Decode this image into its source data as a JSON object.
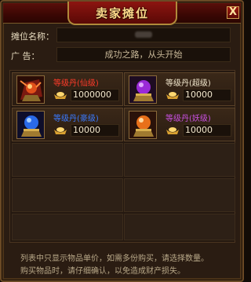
{
  "window": {
    "title": "卖家摊位",
    "close_label": "X"
  },
  "info": {
    "stall_name_label": "摊位名称：",
    "ad_label": "广   告：",
    "ad_text": "成功之路，从头开始"
  },
  "items": [
    {
      "name": "等级丹(仙级)",
      "price": "1000000",
      "name_color": "#ff3b2a",
      "orb_color": "#e03a1a"
    },
    {
      "name": "等级丹(超级)",
      "price": "10000",
      "name_color": "#f0e6cc",
      "orb_color": "#9a2ad8"
    },
    {
      "name": "等级丹(豪级)",
      "price": "10000",
      "name_color": "#3a7aff",
      "orb_color": "#2a6ae8"
    },
    {
      "name": "等级丹(妖级)",
      "price": "10000",
      "name_color": "#c850e0",
      "orb_color": "#e8701a"
    }
  ],
  "footer": {
    "line1": "列表中只显示物品单价，如需多份购买，请选择数量。",
    "line2": "购买物品时，请仔细确认，以免造成财产损失。"
  },
  "colors": {
    "title_bar": "#5a0f0a",
    "panel_bg": "#2a1c12",
    "gold_border": "#b08a3a"
  }
}
